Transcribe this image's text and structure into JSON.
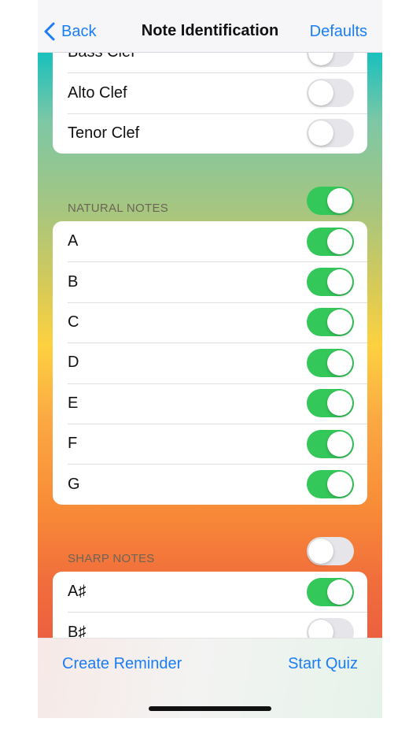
{
  "nav": {
    "back_label": "Back",
    "title": "Note Identification",
    "defaults_label": "Defaults"
  },
  "clefs": {
    "items": [
      {
        "label": "Bass Clef",
        "on": false
      },
      {
        "label": "Alto Clef",
        "on": false
      },
      {
        "label": "Tenor Clef",
        "on": false
      }
    ]
  },
  "natural_notes": {
    "header": "NATURAL NOTES",
    "header_toggle_on": true,
    "items": [
      {
        "label": "A",
        "on": true
      },
      {
        "label": "B",
        "on": true
      },
      {
        "label": "C",
        "on": true
      },
      {
        "label": "D",
        "on": true
      },
      {
        "label": "E",
        "on": true
      },
      {
        "label": "F",
        "on": true
      },
      {
        "label": "G",
        "on": true
      }
    ]
  },
  "sharp_notes": {
    "header": "SHARP NOTES",
    "header_toggle_on": false,
    "items": [
      {
        "label": "A♯",
        "on": true
      },
      {
        "label": "B♯",
        "on": false
      }
    ]
  },
  "bottom_bar": {
    "create_reminder_label": "Create Reminder",
    "start_quiz_label": "Start Quiz"
  },
  "colors": {
    "accent": "#1a7df6",
    "toggle_on": "#34c85a",
    "toggle_off": "#e6e6ea"
  }
}
